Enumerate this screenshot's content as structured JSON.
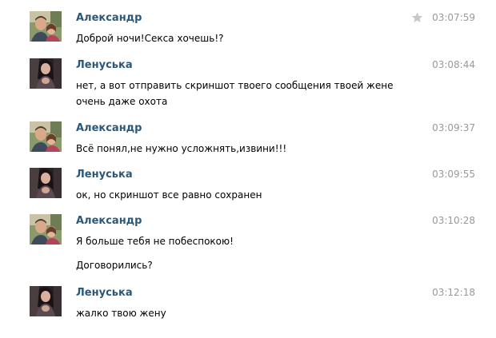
{
  "conversation": {
    "messages": [
      {
        "author": "Александр",
        "time": "03:07:59",
        "starred": true,
        "lines": [
          "Доброй ночи!Секса хочешь!?"
        ],
        "extra": ""
      },
      {
        "author": "Ленуська",
        "time": "03:08:44",
        "starred": false,
        "lines": [
          "нет, а вот отправить скриншот твоего сообщения твоей жене",
          "очень даже охота"
        ],
        "extra": ""
      },
      {
        "author": "Александр",
        "time": "03:09:37",
        "starred": false,
        "lines": [
          "Всё понял,не нужно усложнять,извини!!!"
        ],
        "extra": ""
      },
      {
        "author": "Ленуська",
        "time": "03:09:55",
        "starred": false,
        "lines": [
          "ок, но скриншот все равно сохранен"
        ],
        "extra": ""
      },
      {
        "author": "Александр",
        "time": "03:10:28",
        "starred": false,
        "lines": [
          "Я больше тебя не побеспокою!"
        ],
        "extra": "Договорились?"
      },
      {
        "author": "Ленуська",
        "time": "03:12:18",
        "starred": false,
        "lines": [
          "жалко твою жену"
        ],
        "extra": ""
      }
    ]
  },
  "colors": {
    "author_link": "#2b587a",
    "timestamp": "#999999",
    "star_inactive": "#c8c8c8"
  },
  "icons": {
    "star": "star-icon",
    "avatar_alexander": "avatar-alexander",
    "avatar_lenuska": "avatar-lenuska"
  }
}
